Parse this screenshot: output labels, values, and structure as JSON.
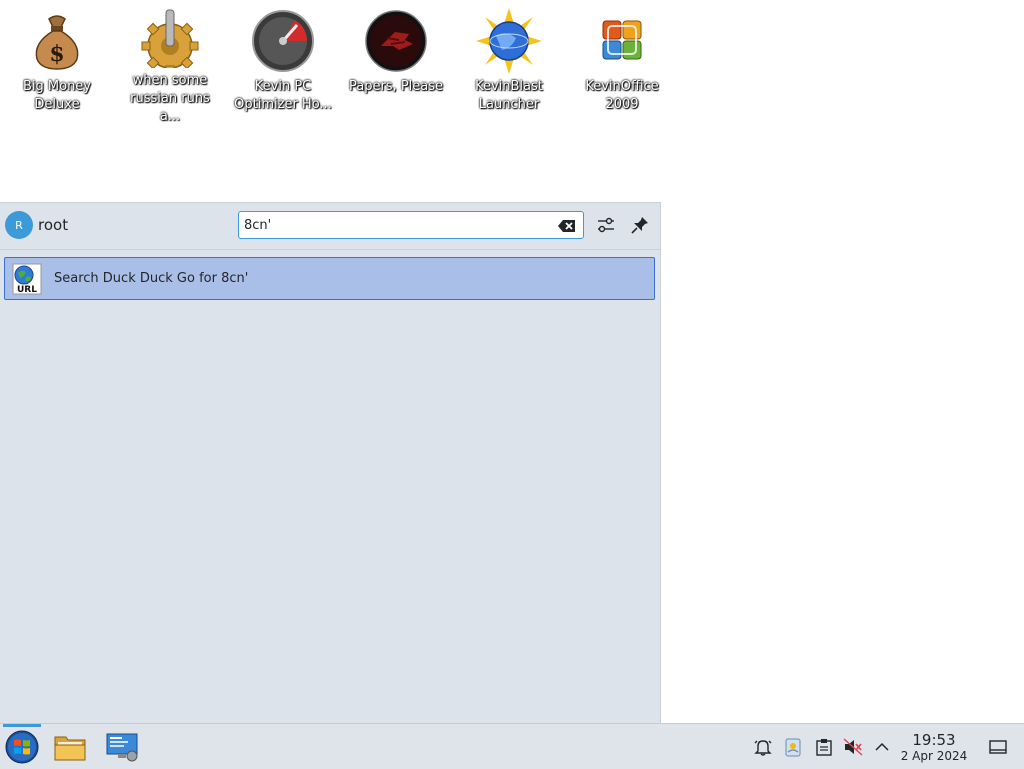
{
  "desktop": {
    "icons": [
      {
        "label": "Big Money Deluxe",
        "icon": "money-bag-icon"
      },
      {
        "label": "when some russian runs a...",
        "icon": "gear-joystick-icon"
      },
      {
        "label": "Kevin PC Optimizer Ho...",
        "icon": "speedometer-icon"
      },
      {
        "label": "Papers, Please",
        "icon": "papers-please-icon"
      },
      {
        "label": "KevinBlast Launcher",
        "icon": "globe-sun-icon"
      },
      {
        "label": "KevinOffice 2009",
        "icon": "office-logo-icon"
      }
    ]
  },
  "launcher": {
    "avatar_letter": "R",
    "username": "root",
    "search": {
      "value": "8cn'",
      "placeholder": ""
    },
    "results": [
      {
        "label": "Search Duck Duck Go for 8cn'",
        "icon": "url-globe-icon"
      }
    ]
  },
  "taskbar": {
    "start_icon": "start-orb-icon",
    "pinned": [
      {
        "name": "file-manager",
        "icon": "folder-icon"
      },
      {
        "name": "system-settings",
        "icon": "computer-settings-icon"
      }
    ],
    "tray": [
      "notifications-icon",
      "clipboard-weather-icon",
      "clipboard-icon",
      "volume-muted-icon",
      "expand-tray-icon"
    ],
    "clock": {
      "time": "19:53",
      "date": "2 Apr 2024"
    }
  },
  "colors": {
    "accent": "#3d9ad8",
    "selection": "#aabfe8",
    "panel": "#dde3ea"
  }
}
